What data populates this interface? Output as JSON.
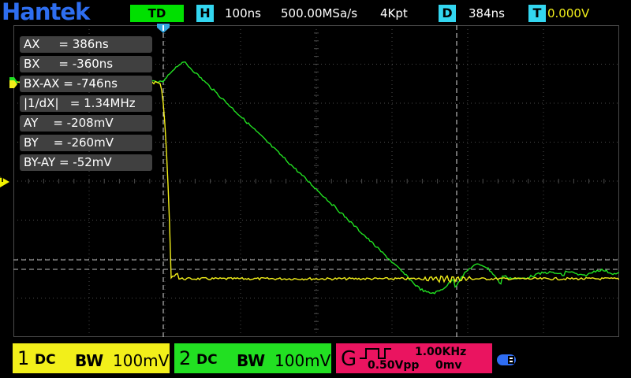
{
  "header": {
    "brand": "Hantek",
    "trigger_mode": "TD",
    "timebase_tag": "H",
    "timebase": "100ns",
    "sample_rate": "500.00MSa/s",
    "memory_depth": "4Kpt",
    "delay_tag": "D",
    "delay": "384ns",
    "trigger_tag": "T",
    "trigger_level": "0.000V"
  },
  "colors": {
    "brand": "#2e6ef0",
    "ch1": "#f2ef1a",
    "ch2": "#22e022",
    "generator": "#ea1460",
    "tag": "#33d6f0",
    "trigger_mode": "#00e000",
    "grid": "#4a4a4a"
  },
  "cursor_readouts": [
    "AX     = 386ns",
    "BX     = -360ns",
    "BX-AX = -746ns",
    "|1/dX|   = 1.34MHz",
    "AY    = -208mV",
    "BY    = -260mV",
    "BY-AY = -52mV"
  ],
  "markers": {
    "trigger_level_label": "T"
  },
  "channels": {
    "ch1": {
      "number": "1",
      "coupling": "DC",
      "bw": "BW",
      "volts_div": "100mV"
    },
    "ch2": {
      "number": "2",
      "coupling": "DC",
      "bw": "BW",
      "volts_div": "100mV"
    }
  },
  "generator": {
    "label": "G",
    "frequency": "1.00KHz",
    "amplitude": "0.50Vpp",
    "offset": "0mv",
    "waveform_icon": "square-wave-icon"
  },
  "icons": {
    "usb": "usb-icon",
    "trigger_position": "trigger-position-icon",
    "trigger_level": "trigger-level-icon"
  }
}
